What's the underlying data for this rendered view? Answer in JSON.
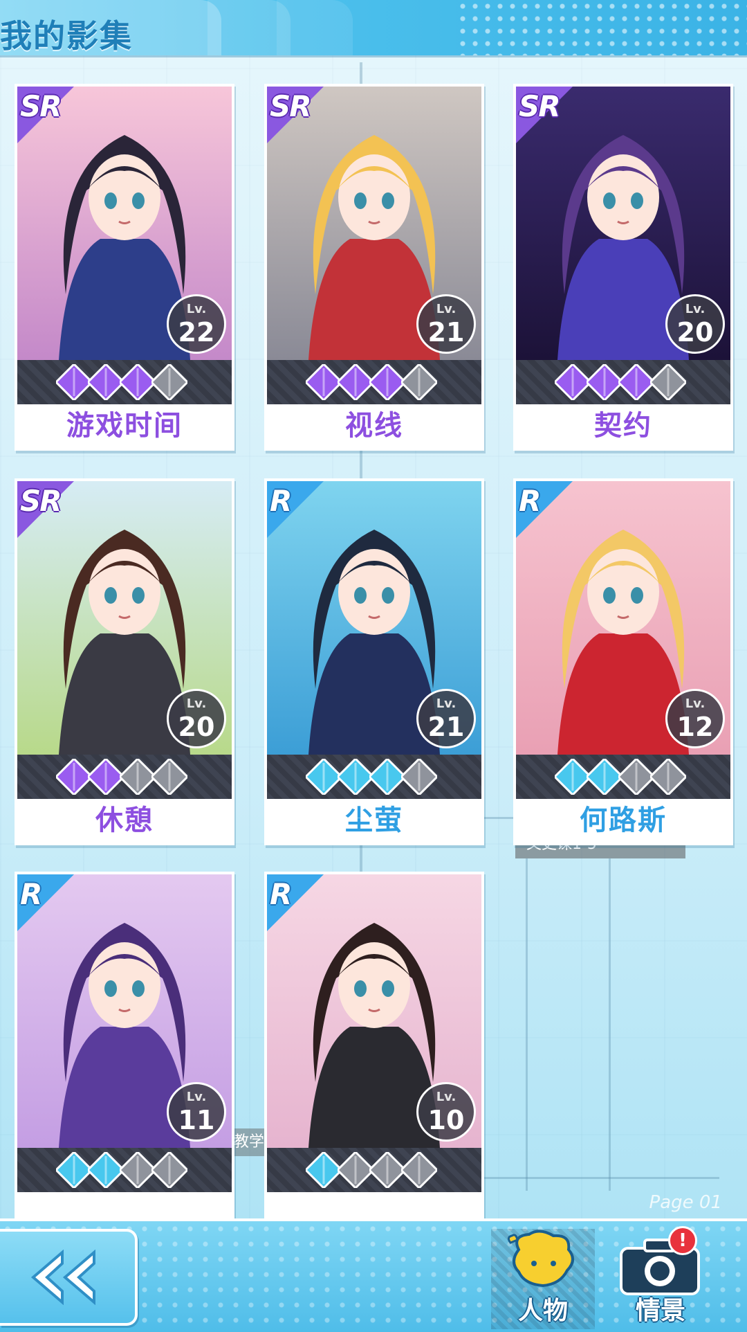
{
  "header": {
    "title": "我的影集"
  },
  "cards": [
    {
      "rarity": "SR",
      "lv_label": "Lv.",
      "level": "22",
      "stars": 3,
      "name": "游戏时间",
      "bg1": "#f7c6d9",
      "bg2": "#c489c9",
      "hair": "#2a2538",
      "outfit": "#2d3e8a"
    },
    {
      "rarity": "SR",
      "lv_label": "Lv.",
      "level": "21",
      "stars": 3,
      "name": "视线",
      "bg1": "#cfc7c2",
      "bg2": "#8a8a96",
      "hair": "#f3c253",
      "outfit": "#c23238"
    },
    {
      "rarity": "SR",
      "lv_label": "Lv.",
      "level": "20",
      "stars": 3,
      "name": "契约",
      "bg1": "#3a2b6e",
      "bg2": "#1c1238",
      "hair": "#5b3a8c",
      "outfit": "#4a3fb8"
    },
    {
      "rarity": "SR",
      "lv_label": "Lv.",
      "level": "20",
      "stars": 2,
      "name": "休憩",
      "bg1": "#d6ecf5",
      "bg2": "#b8d98a",
      "hair": "#4a2a22",
      "outfit": "#3a3a44"
    },
    {
      "rarity": "R",
      "lv_label": "Lv.",
      "level": "21",
      "stars": 3,
      "name": "尘萤",
      "bg1": "#7fd4ef",
      "bg2": "#3c9ed6",
      "hair": "#1f2a3f",
      "outfit": "#23305e"
    },
    {
      "rarity": "R",
      "lv_label": "Lv.",
      "level": "12",
      "stars": 2,
      "name": "何路斯",
      "bg1": "#f6c3cf",
      "bg2": "#e9a0b4",
      "hair": "#f3c866",
      "outfit": "#cc2530"
    },
    {
      "rarity": "R",
      "lv_label": "Lv.",
      "level": "11",
      "stars": 2,
      "name": "",
      "bg1": "#e4c9f0",
      "bg2": "#c49ee3",
      "hair": "#4a2e7a",
      "outfit": "#5a3c9c"
    },
    {
      "rarity": "R",
      "lv_label": "Lv.",
      "level": "10",
      "stars": 1,
      "name": "",
      "bg1": "#f6d7e4",
      "bg2": "#e6b4cf",
      "hair": "#2e1f1f",
      "outfit": "#2a2a30"
    }
  ],
  "nav": {
    "back_icon": "double-chevron-left-icon",
    "tabs": [
      {
        "label": "人物",
        "icon": "character-icon",
        "active": true
      },
      {
        "label": "情景",
        "icon": "camera-icon",
        "active": false,
        "badge": "!"
      }
    ]
  },
  "page_indicator": "Page 01",
  "overlays": {
    "note1": "文史课1-5",
    "note2": "教学"
  },
  "colors": {
    "sr_accent": "#8a58e0",
    "r_accent": "#3aa8ec",
    "star_sr": "#9a5cf0",
    "star_r": "#48c8ee",
    "star_empty": "#8f939c"
  }
}
